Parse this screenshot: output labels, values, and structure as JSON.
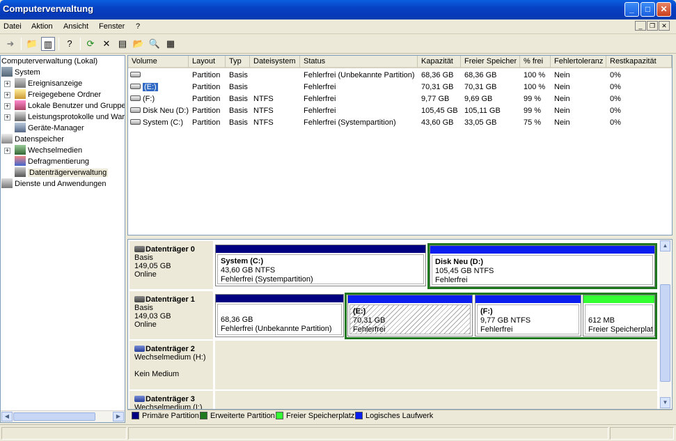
{
  "window": {
    "title": "Computerverwaltung"
  },
  "menu": {
    "items": [
      "Datei",
      "Aktion",
      "Ansicht",
      "Fenster",
      "?"
    ]
  },
  "tree": {
    "nodes": [
      {
        "label": "Computerverwaltung (Lokal)",
        "icon": "computer-icon"
      },
      {
        "label": "System",
        "icon": "system-tools-icon"
      },
      {
        "label": "Ereignisanzeige",
        "icon": "event-viewer-icon"
      },
      {
        "label": "Freigegebene Ordner",
        "icon": "shared-folders-icon"
      },
      {
        "label": "Lokale Benutzer und Gruppen",
        "icon": "users-icon"
      },
      {
        "label": "Leistungsprotokolle und Warnungen",
        "icon": "performance-logs-icon"
      },
      {
        "label": "Geräte-Manager",
        "icon": "device-manager-icon"
      },
      {
        "label": "Datenspeicher",
        "icon": "storage-icon"
      },
      {
        "label": "Wechselmedien",
        "icon": "removable-storage-icon"
      },
      {
        "label": "Defragmentierung",
        "icon": "defrag-icon"
      },
      {
        "label": "Datenträgerverwaltung",
        "icon": "disk-management-icon"
      },
      {
        "label": "Dienste und Anwendungen",
        "icon": "services-icon"
      }
    ]
  },
  "list": {
    "columns": [
      "Volume",
      "Layout",
      "Typ",
      "Dateisystem",
      "Status",
      "Kapazität",
      "Freier Speicher",
      "% frei",
      "Fehlertoleranz",
      "Restkapazität"
    ],
    "rows": [
      [
        "",
        "Partition",
        "Basis",
        "",
        "Fehlerfrei (Unbekannte Partition)",
        "68,36 GB",
        "68,36 GB",
        "100 %",
        "Nein",
        "0%"
      ],
      [
        "(E:)",
        "Partition",
        "Basis",
        "",
        "Fehlerfrei",
        "70,31 GB",
        "70,31 GB",
        "100 %",
        "Nein",
        "0%"
      ],
      [
        "(F:)",
        "Partition",
        "Basis",
        "NTFS",
        "Fehlerfrei",
        "9,77 GB",
        "9,69 GB",
        "99 %",
        "Nein",
        "0%"
      ],
      [
        "Disk Neu (D:)",
        "Partition",
        "Basis",
        "NTFS",
        "Fehlerfrei",
        "105,45 GB",
        "105,11 GB",
        "99 %",
        "Nein",
        "0%"
      ],
      [
        "System (C:)",
        "Partition",
        "Basis",
        "NTFS",
        "Fehlerfrei (Systempartition)",
        "43,60 GB",
        "33,05 GB",
        "75 %",
        "Nein",
        "0%"
      ]
    ]
  },
  "disks": [
    {
      "name": "Datenträger 0",
      "type": "Basis",
      "size": "149,05 GB",
      "state": "Online",
      "volumes": [
        {
          "title": "System  (C:)",
          "line1": "43,60 GB NTFS",
          "line2": "Fehlerfrei (Systempartition)"
        },
        {
          "title": "Disk Neu  (D:)",
          "line1": "105,45 GB NTFS",
          "line2": "Fehlerfrei"
        }
      ]
    },
    {
      "name": "Datenträger 1",
      "type": "Basis",
      "size": "149,03 GB",
      "state": "Online",
      "volumes": [
        {
          "title": "",
          "line1": "68,36 GB",
          "line2": "Fehlerfrei (Unbekannte Partition)"
        },
        {
          "title": "(E:)",
          "line1": "70,31 GB",
          "line2": "Fehlerfrei"
        },
        {
          "title": "(F:)",
          "line1": "9,77 GB NTFS",
          "line2": "Fehlerfrei"
        },
        {
          "title": "",
          "line1": "612 MB",
          "line2": "Freier Speicherplatz"
        }
      ]
    },
    {
      "name": "Datenträger 2",
      "type": "Wechselmedium (H:)",
      "state": "Kein Medium"
    },
    {
      "name": "Datenträger 3",
      "type": "Wechselmedium (I:)"
    }
  ],
  "legend": [
    {
      "label": "Primäre Partition",
      "color": "#000080"
    },
    {
      "label": "Erweiterte Partition",
      "color": "#1f7a1f"
    },
    {
      "label": "Freier Speicherplatz",
      "color": "#33ff33"
    },
    {
      "label": "Logisches Laufwerk",
      "color": "#0a1ef0"
    }
  ],
  "colors": {
    "primary": "#000080",
    "extended": "#1f7a1f",
    "free": "#33ff33",
    "logical": "#0a1ef0"
  }
}
